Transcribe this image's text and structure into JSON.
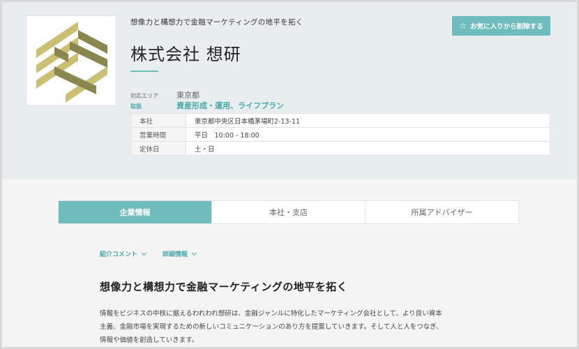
{
  "header": {
    "tagline": "想像力と構想力で金融マーケティングの地平を拓く",
    "company_name": "株式会社 想研",
    "favorite_button": {
      "icon": "star-icon",
      "label": "お気に入りから削除する"
    },
    "meta": {
      "area_label": "対応エリア",
      "area_value": "東京都",
      "handling_label": "取扱",
      "handling_value": "資産形成・運用、ライフプラン"
    },
    "info_table": [
      {
        "label": "本社",
        "value": "東京都中央区日本橋茅場町2-13-11"
      },
      {
        "label": "営業時間",
        "value": "平日　10:00 - 18:00"
      },
      {
        "label": "定休日",
        "value": "土・日"
      }
    ]
  },
  "tabs": [
    {
      "label": "企業情報",
      "active": true
    },
    {
      "label": "本社・支店",
      "active": false
    },
    {
      "label": "所属アドバイザー",
      "active": false
    }
  ],
  "subnav": [
    {
      "label": "紹介コメント",
      "icon": "chevron-down-icon"
    },
    {
      "label": "詳細情報",
      "icon": "chevron-down-icon"
    }
  ],
  "content": {
    "heading": "想像力と構想力で金融マーケティングの地平を拓く",
    "paragraph_lines": [
      "情報をビジネスの中核に据えるわれわれ想研は、金融ジャンルに特化したマーケティング会社として、より良い資本",
      "主義、金融市場を実現するための新しいコミュニケーションのあり方を提案していきます。そして人と人をつなぎ、",
      "情報や価値を創造していきます。"
    ]
  },
  "colors": {
    "accent": "#6fbcbd",
    "accent_text": "#4aa7a8",
    "hero_bg": "#e8eef0",
    "logo_gold": "#cbbf74",
    "logo_olive": "#8a8650"
  }
}
